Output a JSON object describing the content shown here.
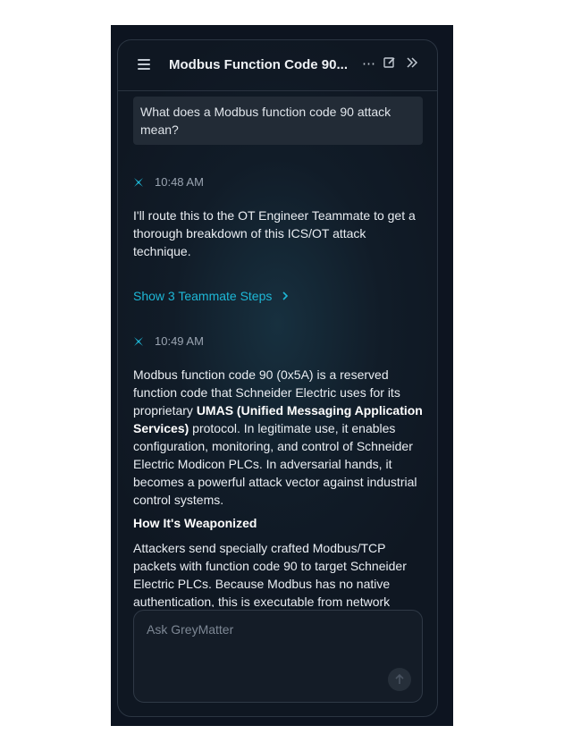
{
  "header": {
    "title": "Modbus Function Code 90...",
    "icons": [
      "menu-icon",
      "more-icon",
      "edit-icon",
      "collapse-icon"
    ]
  },
  "conversation": {
    "user_message": "What does a Modbus function code 90 attack mean?",
    "reply1": {
      "time": "10:48 AM",
      "text": "I'll route this to the OT Engineer Teammate to get a thorough breakdown of this ICS/OT attack technique."
    },
    "steps_link": "Show 3 Teammate Steps",
    "reply2": {
      "time": "10:49 AM",
      "p1_a": "Modbus function code 90 (0x5A) is a reserved function code that Schneider Electric uses for its proprietary ",
      "p1_bold": "UMAS (Unified Messaging Application Services)",
      "p1_b": " protocol. In legitimate use, it enables configuration, monitoring, and control of Schneider Electric Modicon PLCs. In adversarial hands, it becomes a powerful attack vector against industrial control systems.",
      "heading": "How It's Weaponized",
      "p2": "Attackers send specially crafted Modbus/TCP packets with function code 90 to target Schneider Electric PLCs. Because Modbus has no native authentication, this is executable from network"
    }
  },
  "input": {
    "placeholder": "Ask GreyMatter"
  },
  "colors": {
    "accent": "#1eb7d6",
    "background": "#0d1420"
  }
}
